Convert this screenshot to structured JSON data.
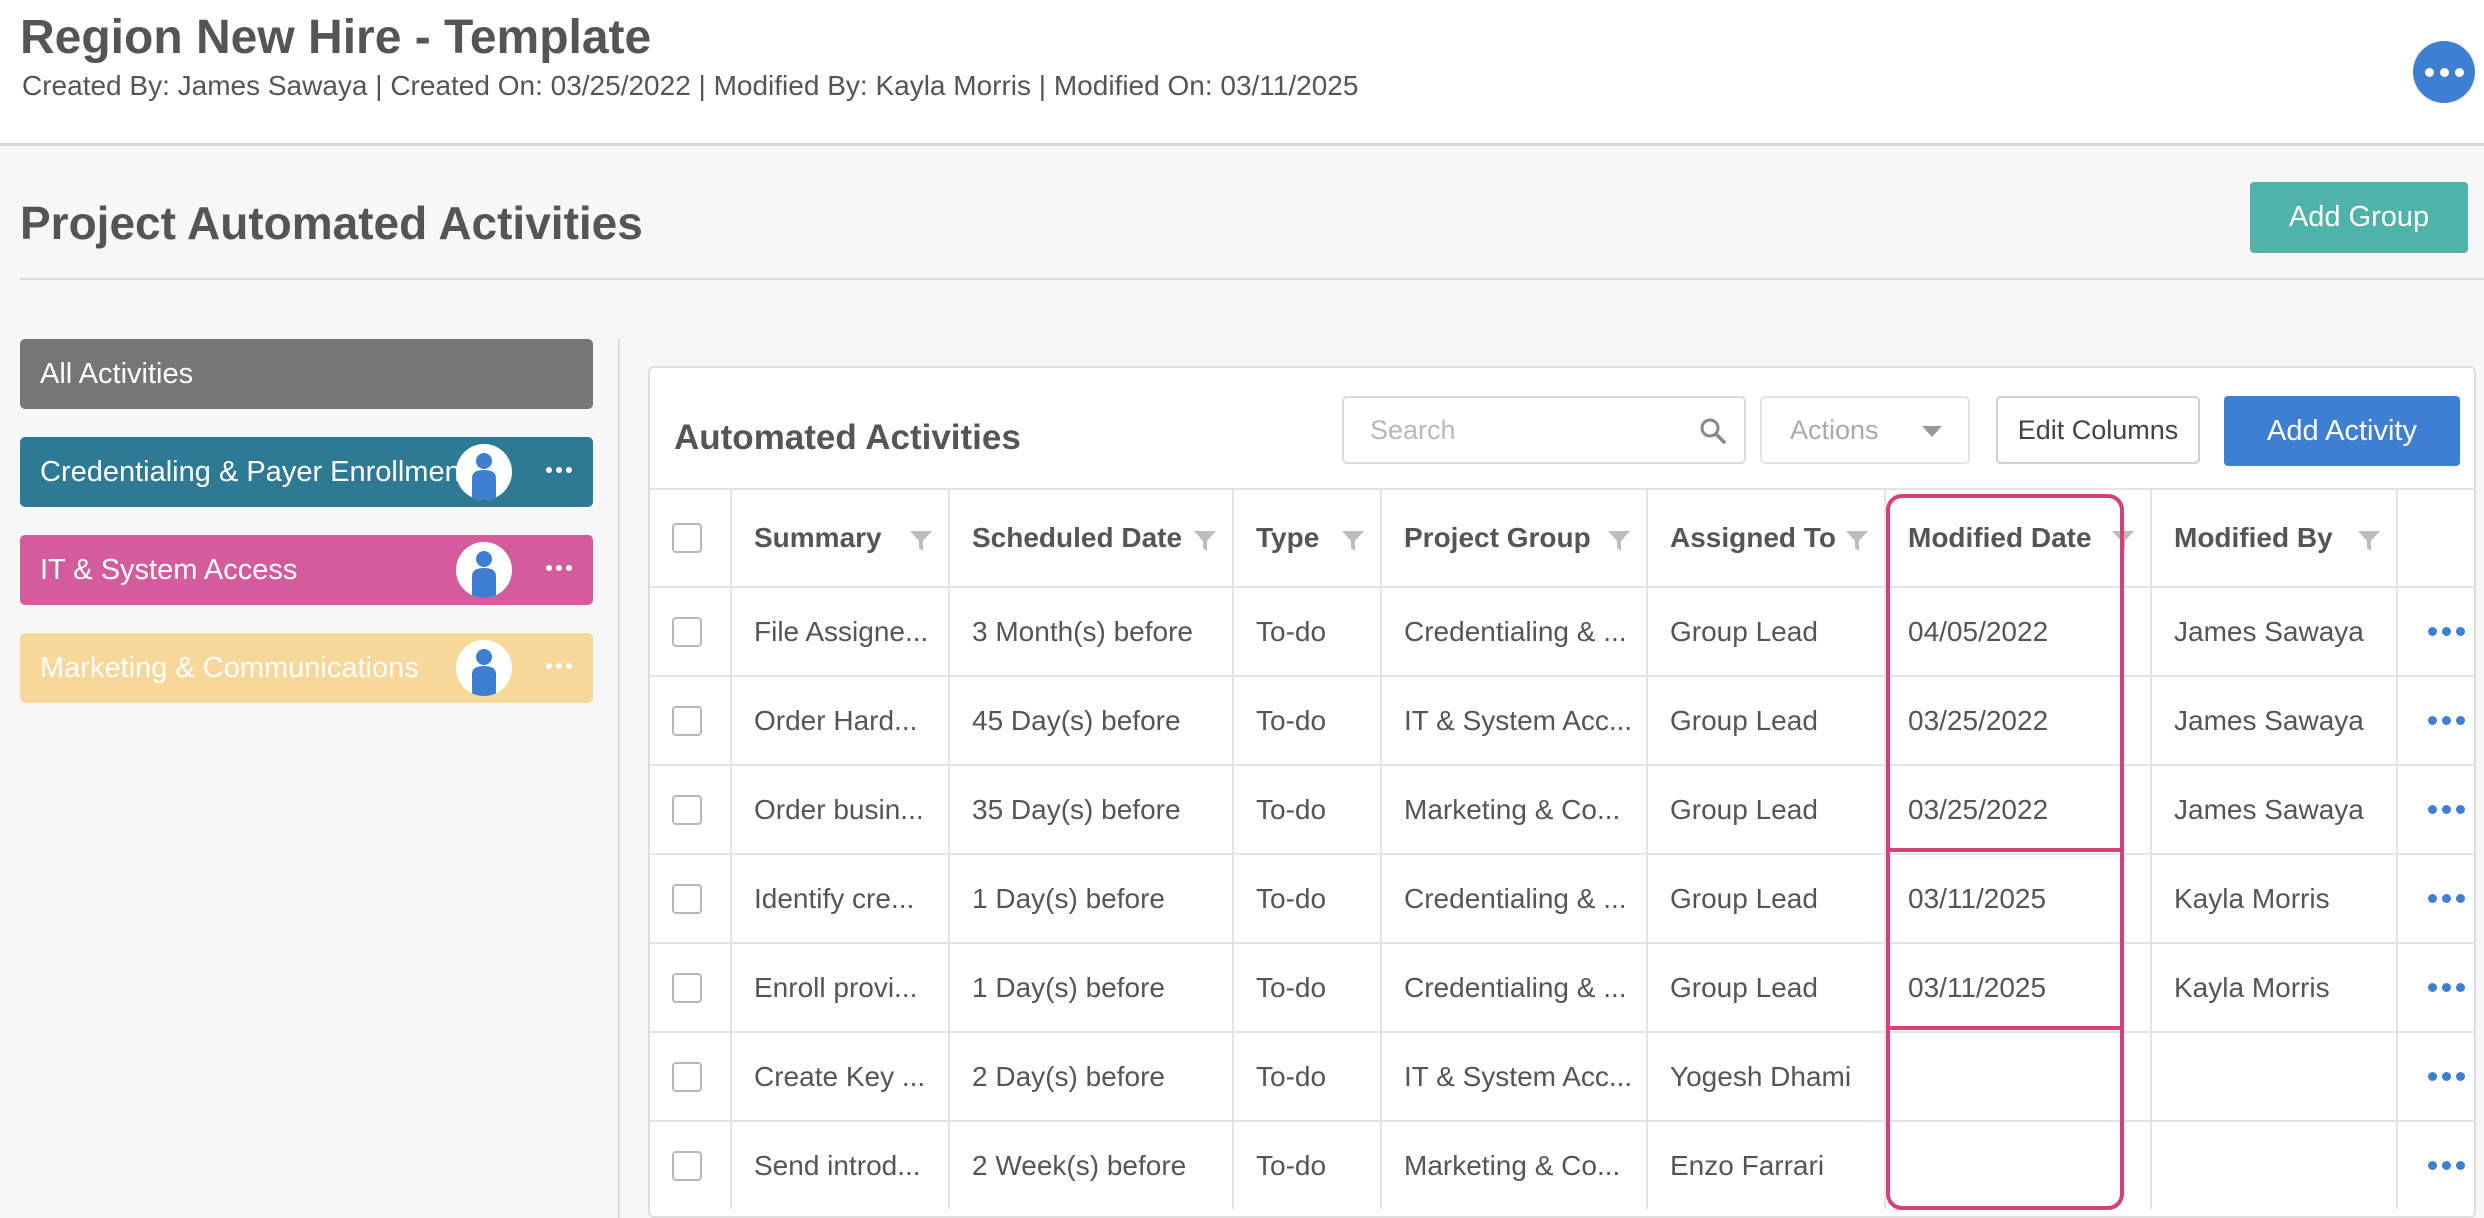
{
  "header": {
    "title": "Region New Hire - Template",
    "meta": "Created By: James Sawaya | Created On: 03/25/2022 | Modified By: Kayla Morris | Modified On: 03/11/2025"
  },
  "section": {
    "title": "Project Automated Activities",
    "add_group_label": "Add Group"
  },
  "groups": [
    {
      "label": "All Activities",
      "color": "#767676"
    },
    {
      "label": "Credentialing & Payer Enrollment",
      "color": "#2e7a94"
    },
    {
      "label": "IT & System Access",
      "color": "#d45c9c"
    },
    {
      "label": "Marketing & Communications",
      "color": "#f8d79b"
    }
  ],
  "panel": {
    "title": "Automated Activities",
    "search_placeholder": "Search",
    "actions_label": "Actions",
    "edit_columns_label": "Edit Columns",
    "add_activity_label": "Add Activity"
  },
  "table": {
    "columns": [
      "Summary",
      "Scheduled Date",
      "Type",
      "Project Group",
      "Assigned To",
      "Modified Date",
      "Modified By"
    ],
    "rows": [
      [
        "File Assigne...",
        "3 Month(s) before",
        "To-do",
        "Credentialing & ...",
        "Group Lead",
        "04/05/2022",
        "James Sawaya"
      ],
      [
        "Order Hard...",
        "45 Day(s) before",
        "To-do",
        "IT & System Acc...",
        "Group Lead",
        "03/25/2022",
        "James Sawaya"
      ],
      [
        "Order busin...",
        "35 Day(s) before",
        "To-do",
        "Marketing & Co...",
        "Group Lead",
        "03/25/2022",
        "James Sawaya"
      ],
      [
        "Identify cre...",
        "1 Day(s) before",
        "To-do",
        "Credentialing & ...",
        "Group Lead",
        "03/11/2025",
        "Kayla Morris"
      ],
      [
        "Enroll provi...",
        "1 Day(s) before",
        "To-do",
        "Credentialing & ...",
        "Group Lead",
        "03/11/2025",
        "Kayla Morris"
      ],
      [
        "Create Key ...",
        "2 Day(s) before",
        "To-do",
        "IT & System Acc...",
        "Yogesh Dhami",
        "",
        ""
      ],
      [
        "Send introd...",
        "2 Week(s) before",
        "To-do",
        "Marketing & Co...",
        "Enzo Farrari",
        "",
        ""
      ]
    ]
  },
  "colors": {
    "accent_blue": "#3f7fd1",
    "teal": "#4fb3aa",
    "highlight": "#d4407a"
  },
  "icons": {
    "header_more": "more-horizontal-icon",
    "search": "search-icon",
    "filter": "filter-icon",
    "avatar": "user-avatar-icon",
    "row_menu": "more-horizontal-icon"
  }
}
